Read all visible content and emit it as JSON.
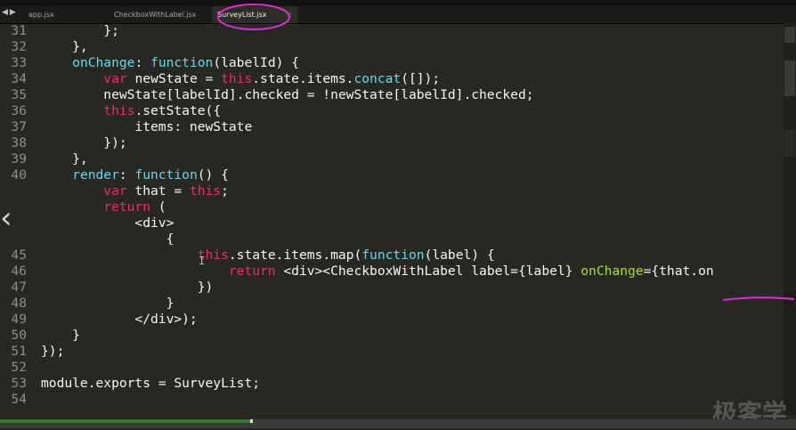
{
  "tabs": [
    {
      "label": "app.jsx",
      "active": false
    },
    {
      "label": "CheckboxWithLabel.jsx",
      "active": false
    },
    {
      "label": "SurveyList.jsx",
      "active": true
    }
  ],
  "nav": {
    "back_icon": "◀",
    "forward_icon": "▶"
  },
  "close_icon": "×",
  "side_arrow": "‹",
  "watermark": "极客学",
  "lines": [
    {
      "n": "31",
      "tokens": [
        {
          "t": "        };",
          "c": ""
        }
      ]
    },
    {
      "n": "32",
      "tokens": [
        {
          "t": "    },",
          "c": ""
        }
      ]
    },
    {
      "n": "33",
      "tokens": [
        {
          "t": "    ",
          "c": ""
        },
        {
          "t": "onChange",
          "c": "fn"
        },
        {
          "t": ": ",
          "c": ""
        },
        {
          "t": "function",
          "c": "fn"
        },
        {
          "t": "(labelId) {",
          "c": ""
        }
      ]
    },
    {
      "n": "34",
      "tokens": [
        {
          "t": "        ",
          "c": ""
        },
        {
          "t": "var",
          "c": "kw"
        },
        {
          "t": " newState = ",
          "c": ""
        },
        {
          "t": "this",
          "c": "kw"
        },
        {
          "t": ".state.items.",
          "c": ""
        },
        {
          "t": "concat",
          "c": "fn"
        },
        {
          "t": "([]);",
          "c": ""
        }
      ]
    },
    {
      "n": "35",
      "tokens": [
        {
          "t": "        newState[labelId].checked = !newState[labelId].checked;",
          "c": ""
        }
      ]
    },
    {
      "n": "36",
      "tokens": [
        {
          "t": "        ",
          "c": ""
        },
        {
          "t": "this",
          "c": "kw"
        },
        {
          "t": ".setState({",
          "c": ""
        }
      ]
    },
    {
      "n": "37",
      "tokens": [
        {
          "t": "            items: newState",
          "c": ""
        }
      ]
    },
    {
      "n": "38",
      "tokens": [
        {
          "t": "        });",
          "c": ""
        }
      ]
    },
    {
      "n": "39",
      "tokens": [
        {
          "t": "    },",
          "c": ""
        }
      ]
    },
    {
      "n": "40",
      "tokens": [
        {
          "t": "    ",
          "c": ""
        },
        {
          "t": "render",
          "c": "fn"
        },
        {
          "t": ": ",
          "c": ""
        },
        {
          "t": "function",
          "c": "fn"
        },
        {
          "t": "() {",
          "c": ""
        }
      ]
    },
    {
      "n": "",
      "tokens": [
        {
          "t": "        ",
          "c": ""
        },
        {
          "t": "var",
          "c": "kw"
        },
        {
          "t": " that = ",
          "c": ""
        },
        {
          "t": "this",
          "c": "kw"
        },
        {
          "t": ";",
          "c": ""
        }
      ]
    },
    {
      "n": "",
      "tokens": [
        {
          "t": "        ",
          "c": ""
        },
        {
          "t": "return",
          "c": "kw"
        },
        {
          "t": " (",
          "c": ""
        }
      ]
    },
    {
      "n": "",
      "tokens": [
        {
          "t": "            <div>",
          "c": ""
        }
      ]
    },
    {
      "n": "",
      "tokens": [
        {
          "t": "                {",
          "c": ""
        }
      ]
    },
    {
      "n": "45",
      "tokens": [
        {
          "t": "                    ",
          "c": ""
        },
        {
          "t": "this",
          "c": "kw"
        },
        {
          "t": ".state.items.map(",
          "c": ""
        },
        {
          "t": "function",
          "c": "fn"
        },
        {
          "t": "(label) {",
          "c": ""
        }
      ]
    },
    {
      "n": "46",
      "tokens": [
        {
          "t": "                        ",
          "c": ""
        },
        {
          "t": "return",
          "c": "kw"
        },
        {
          "t": " <div><CheckboxWithLabel label={label} ",
          "c": ""
        },
        {
          "t": "onChange",
          "c": "key"
        },
        {
          "t": "={that.on",
          "c": ""
        }
      ]
    },
    {
      "n": "47",
      "tokens": [
        {
          "t": "                    })",
          "c": ""
        }
      ]
    },
    {
      "n": "48",
      "tokens": [
        {
          "t": "                }",
          "c": ""
        }
      ]
    },
    {
      "n": "49",
      "tokens": [
        {
          "t": "            </div>);",
          "c": ""
        }
      ]
    },
    {
      "n": "50",
      "tokens": [
        {
          "t": "    }",
          "c": ""
        }
      ]
    },
    {
      "n": "51",
      "tokens": [
        {
          "t": "});",
          "c": ""
        }
      ]
    },
    {
      "n": "52",
      "tokens": [
        {
          "t": "",
          "c": ""
        }
      ]
    },
    {
      "n": "53",
      "tokens": [
        {
          "t": "module.exports = SurveyList;",
          "c": ""
        }
      ]
    },
    {
      "n": "54",
      "tokens": [
        {
          "t": "",
          "c": ""
        }
      ]
    }
  ]
}
